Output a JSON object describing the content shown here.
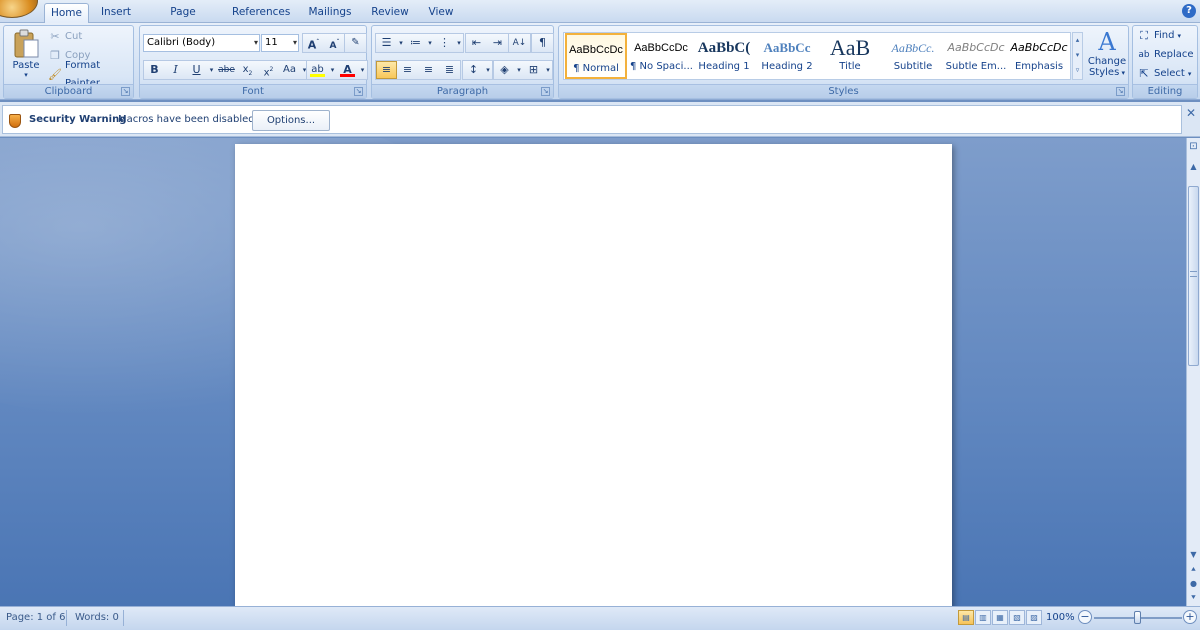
{
  "tabs": [
    "Home",
    "Insert",
    "Page Layout",
    "References",
    "Mailings",
    "Review",
    "View"
  ],
  "active_tab": "Home",
  "help_glyph": "?",
  "clipboard": {
    "paste_label": "Paste",
    "cut_label": "Cut",
    "copy_label": "Copy",
    "format_painter_label": "Format Painter",
    "group_label": "Clipboard"
  },
  "font": {
    "font_name": "Calibri (Body)",
    "font_size": "11",
    "group_label": "Font",
    "highlight_color": "#ffff00",
    "font_color": "#ff0000"
  },
  "paragraph": {
    "group_label": "Paragraph"
  },
  "styles": {
    "group_label": "Styles",
    "items": [
      {
        "preview": "AaBbCcDc",
        "name": "¶ Normal",
        "selected": true
      },
      {
        "preview": "AaBbCcDc",
        "name": "¶ No Spaci...",
        "selected": false
      },
      {
        "preview": "AaBbC(",
        "name": "Heading 1",
        "selected": false
      },
      {
        "preview": "AaBbCc",
        "name": "Heading 2",
        "selected": false
      },
      {
        "preview": "AaB",
        "name": "Title",
        "selected": false
      },
      {
        "preview": "AaBbCc.",
        "name": "Subtitle",
        "selected": false
      },
      {
        "preview": "AaBbCcDc",
        "name": "Subtle Em...",
        "selected": false
      },
      {
        "preview": "AaBbCcDc",
        "name": "Emphasis",
        "selected": false
      }
    ],
    "change_styles_line1": "Change",
    "change_styles_line2": "Styles"
  },
  "editing": {
    "group_label": "Editing",
    "find_label": "Find",
    "replace_label": "Replace",
    "select_label": "Select"
  },
  "security": {
    "title": "Security Warning",
    "message": "Macros have been disabled.",
    "options_label": "Options..."
  },
  "status": {
    "page_info": "Page: 1 of 6",
    "word_count": "Words: 0",
    "zoom_level": "100%",
    "zoom_percent": 100
  }
}
